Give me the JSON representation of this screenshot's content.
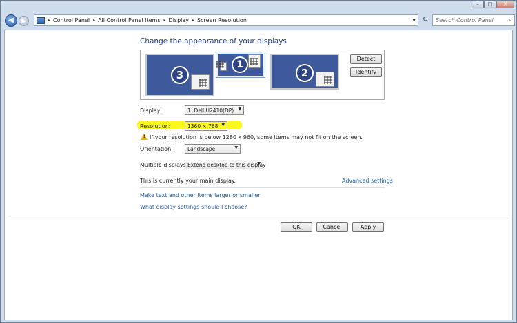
{
  "window": {
    "min": "–",
    "max": "□",
    "close": "✕"
  },
  "address": {
    "back_glyph": "◀",
    "fwd_glyph": "▶",
    "crumbs": [
      "Control Panel",
      "All Control Panel Items",
      "Display",
      "Screen Resolution"
    ],
    "separator": "▸",
    "dropdown": "▼",
    "refresh": "↻",
    "search_placeholder": "Search Control Panel",
    "search_icon": "⌕"
  },
  "page": {
    "heading": "Change the appearance of your displays",
    "monitors": [
      "3",
      "1",
      "2"
    ],
    "detect_label": "Detect",
    "identify_label": "Identify",
    "display_label": "Display:",
    "display_value": "1. Dell U2410(DP)",
    "resolution_label": "Resolution:",
    "resolution_value": "1360 × 768",
    "warning_text": "If your resolution is below 1280 x 960, some items may not fit on the screen.",
    "orientation_label": "Orientation:",
    "orientation_value": "Landscape",
    "multiple_label": "Multiple displays:",
    "multiple_value": "Extend desktop to this display",
    "main_display_text": "This is currently your main display.",
    "advanced_link": "Advanced settings",
    "link_text_size": "Make text and other items larger or smaller",
    "link_which_settings": "What display settings should I choose?",
    "ok_label": "OK",
    "cancel_label": "Cancel",
    "apply_label": "Apply",
    "caret": "▼",
    "warn_glyph": "!"
  },
  "colors": {
    "highlight": "#faf91a",
    "monitor": "#3e5a9c",
    "link": "#1f5ca8"
  }
}
